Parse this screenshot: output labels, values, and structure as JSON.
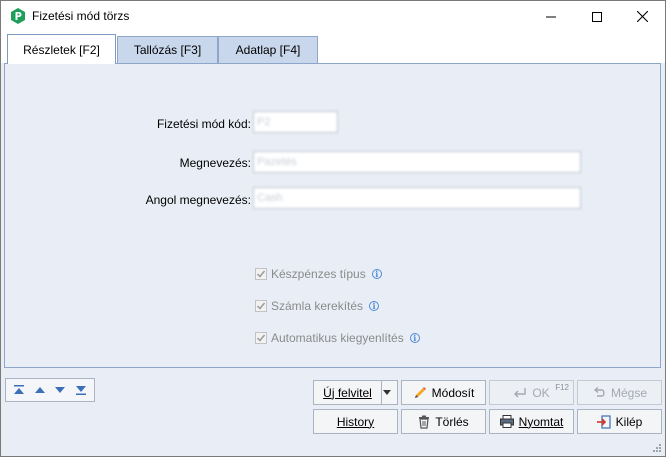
{
  "window": {
    "title": "Fizetési mód törzs",
    "controls": {
      "minimize": "minimize-icon",
      "maximize": "maximize-icon",
      "close": "close-icon"
    }
  },
  "tabs": [
    {
      "label": "Részletek [F2]",
      "active": true
    },
    {
      "label": "Tallózás [F3]",
      "active": false
    },
    {
      "label": "Adatlap [F4]",
      "active": false
    }
  ],
  "form": {
    "code_label": "Fizetési mód kód:",
    "code_value": "P2",
    "name_label": "Megnevezés:",
    "name_value": "Pazetés",
    "english_label": "Angol megnevezés:",
    "english_value": "Cash"
  },
  "checkboxes": [
    {
      "label": "Készpénzes típus",
      "checked": true
    },
    {
      "label": "Számla kerekítés",
      "checked": true
    },
    {
      "label": "Automatikus kiegyenlítés",
      "checked": true
    }
  ],
  "buttons": {
    "new": "Új felvitel",
    "modify": "Módosít",
    "ok": "OK",
    "ok_shortcut": "F12",
    "cancel": "Mégse",
    "history": "History",
    "delete": "Törlés",
    "print": "Nyomtat",
    "exit": "Kilép"
  },
  "colors": {
    "accent": "#1e9e5a",
    "tab_inactive": "#c8d7ec",
    "panel_bg": "#e9eef6",
    "info_blue": "#4e8ad6"
  }
}
